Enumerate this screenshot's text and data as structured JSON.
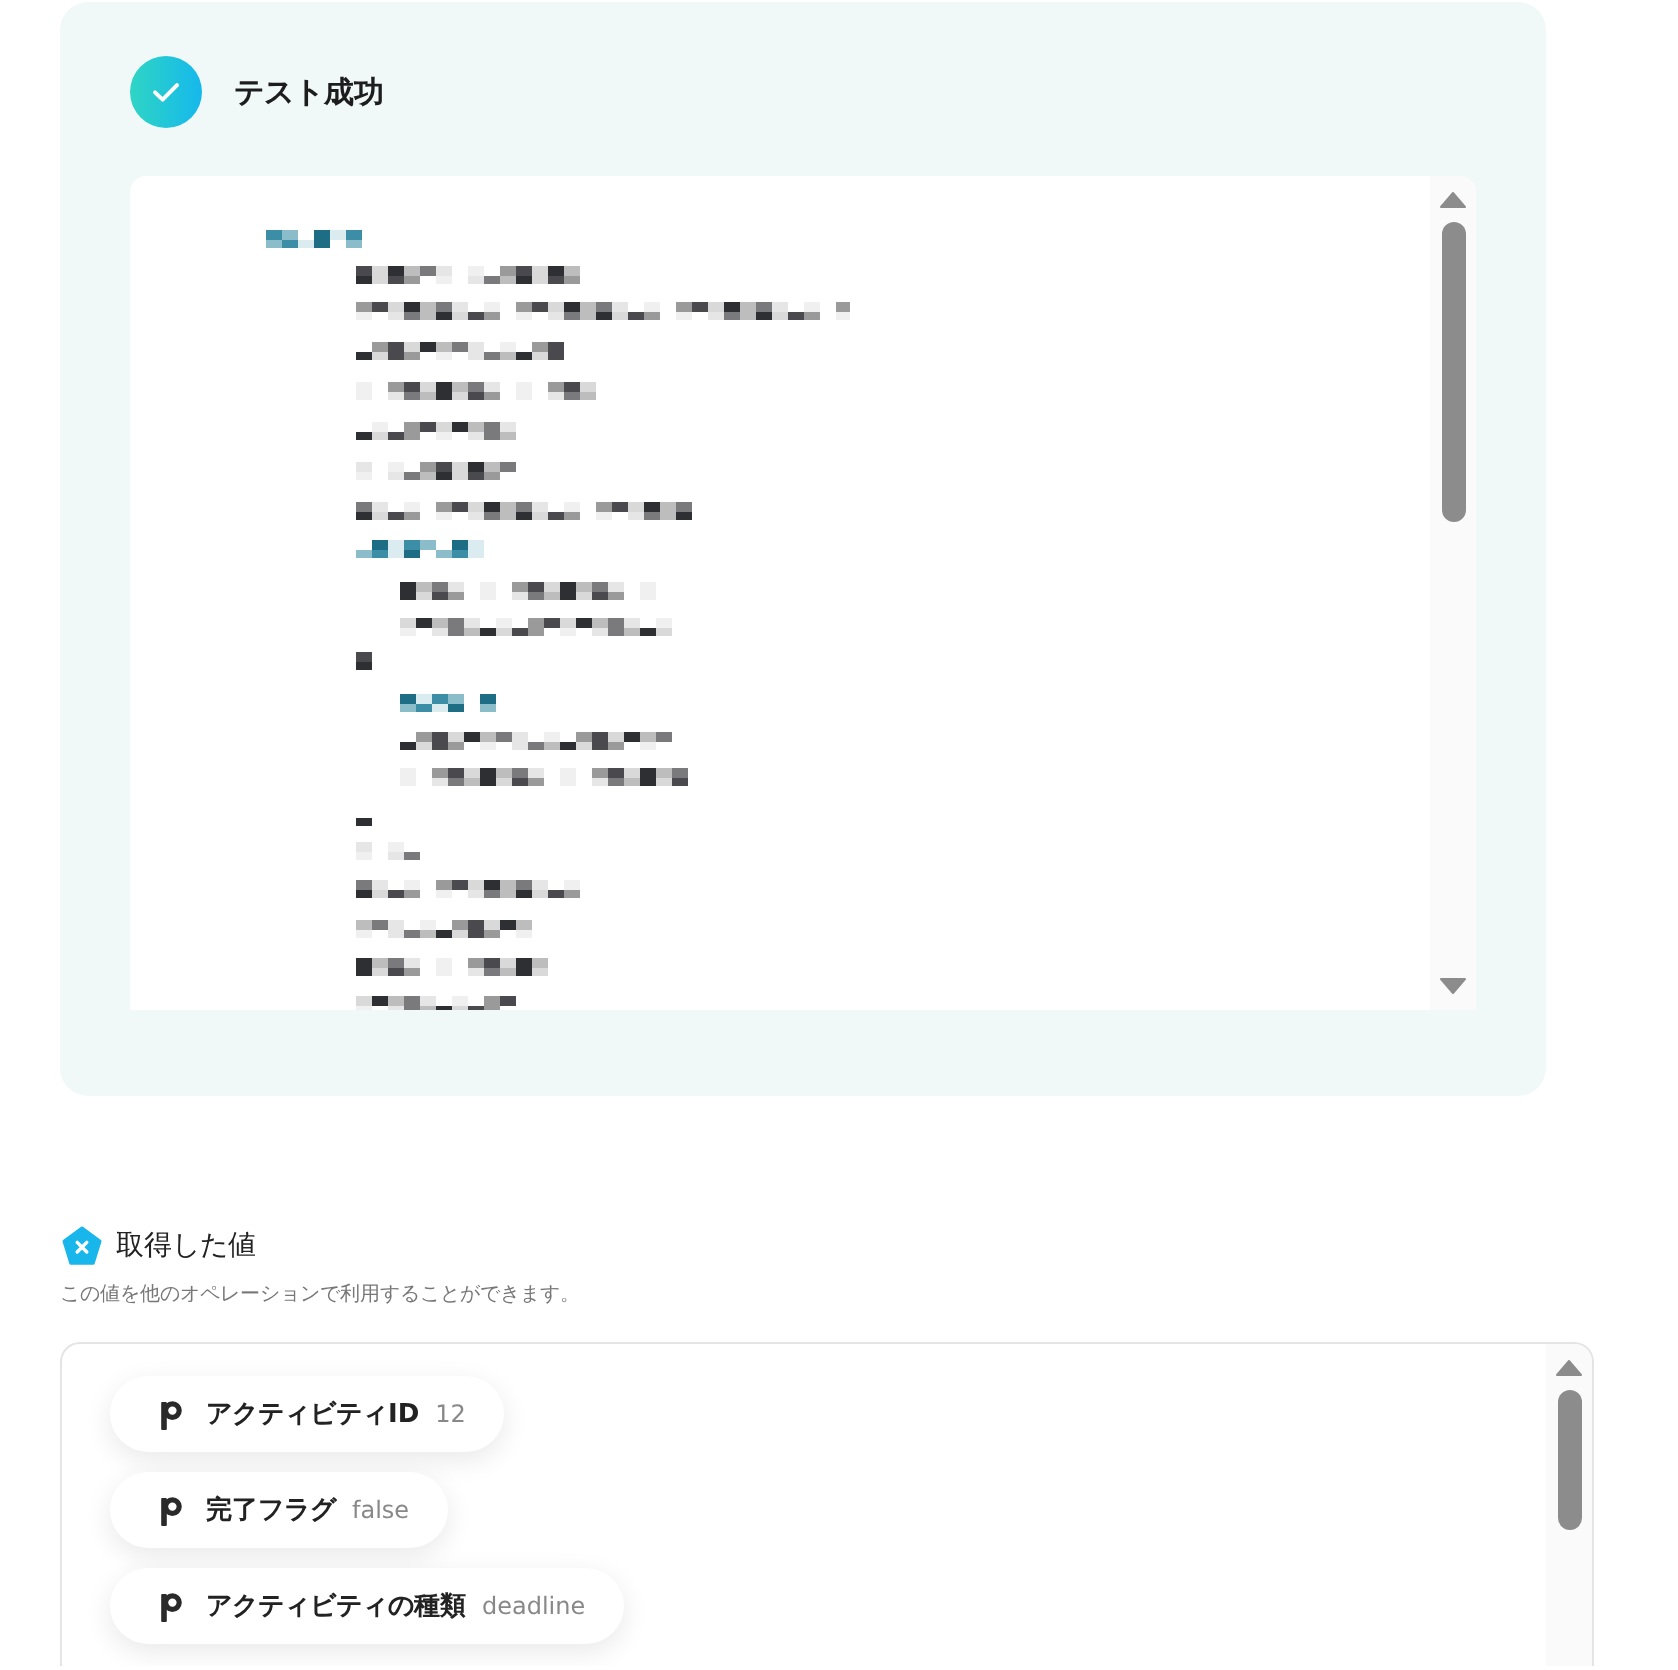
{
  "test_result": {
    "title": "テスト成功"
  },
  "output_values": {
    "title": "取得した値",
    "description": "この値を他のオペレーションで利用することができます。",
    "items": [
      {
        "label": "アクティビティID",
        "value": "12"
      },
      {
        "label": "完了フラグ",
        "value": "false"
      },
      {
        "label": "アクティビティの種類",
        "value": "deadline"
      }
    ]
  }
}
